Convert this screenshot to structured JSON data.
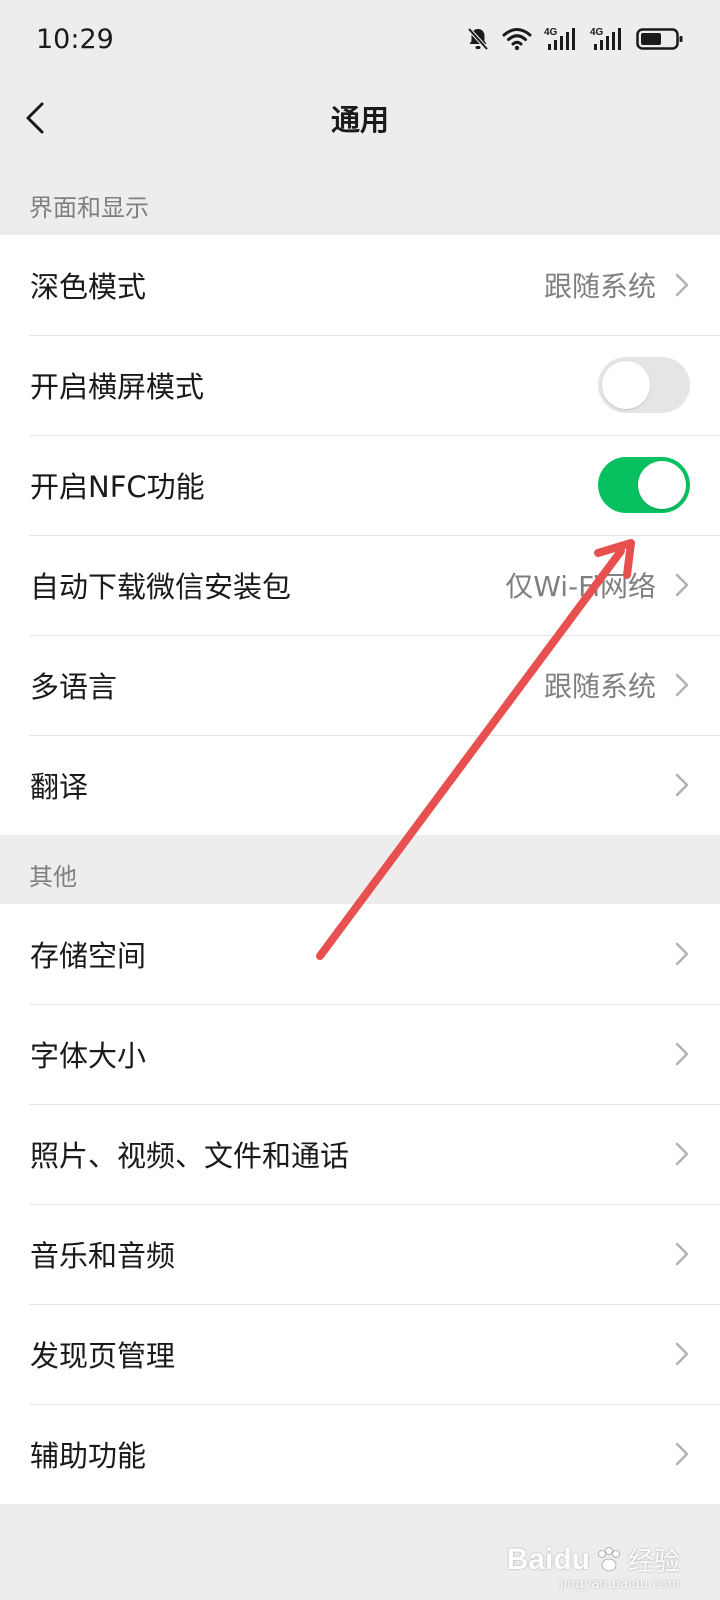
{
  "status_bar": {
    "time": "10:29",
    "icons": [
      "bell-muted-icon",
      "wifi-icon",
      "signal-4g-icon",
      "signal-4g-icon",
      "battery-icon"
    ],
    "network_label": "4G"
  },
  "nav": {
    "title": "通用",
    "back_icon": "chevron-left-icon"
  },
  "sections": [
    {
      "header": "界面和显示",
      "items": [
        {
          "label": "深色模式",
          "value": "跟随系统",
          "type": "link"
        },
        {
          "label": "开启横屏模式",
          "type": "toggle",
          "state": "off"
        },
        {
          "label": "开启NFC功能",
          "type": "toggle",
          "state": "on"
        },
        {
          "label": "自动下载微信安装包",
          "value": "仅Wi-Fi网络",
          "type": "link"
        },
        {
          "label": "多语言",
          "value": "跟随系统",
          "type": "link"
        },
        {
          "label": "翻译",
          "value": "",
          "type": "link"
        }
      ]
    },
    {
      "header": "其他",
      "items": [
        {
          "label": "存储空间",
          "type": "link"
        },
        {
          "label": "字体大小",
          "type": "link"
        },
        {
          "label": "照片、视频、文件和通话",
          "type": "link"
        },
        {
          "label": "音乐和音频",
          "type": "link"
        },
        {
          "label": "发现页管理",
          "type": "link"
        },
        {
          "label": "辅助功能",
          "type": "link"
        }
      ]
    }
  ],
  "colors": {
    "toggle_on": "#07c160",
    "toggle_off": "#e5e5e5",
    "annotation_arrow": "#e85050",
    "background": "#ededed"
  },
  "watermark": {
    "brand": "Baidu",
    "sub": "经验",
    "url": "jingyan.baidu.com"
  }
}
